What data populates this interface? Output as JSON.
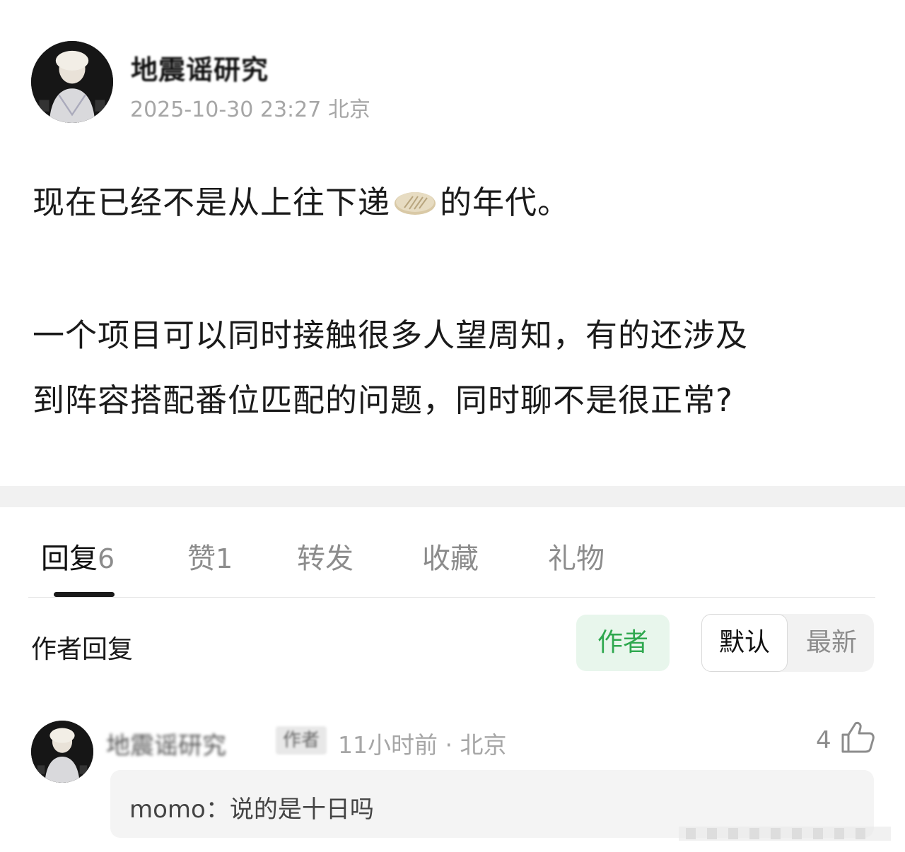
{
  "post": {
    "author_name": "地震谣研究",
    "timestamp": "2025-10-30 23:27",
    "location": "北京",
    "content": {
      "line1_before": "现在已经不是从上往下递",
      "line1_emoji": "pancake-emoji",
      "line1_after": "的年代。",
      "line2": "一个项目可以同时接触很多人望周知，有的还涉及",
      "line3": "到阵容搭配番位匹配的问题，同时聊不是很正常?"
    }
  },
  "tabs": [
    {
      "label": "回复",
      "count": "6"
    },
    {
      "label": "赞",
      "count": "1"
    },
    {
      "label": "转发",
      "count": ""
    },
    {
      "label": "收藏",
      "count": ""
    },
    {
      "label": "礼物",
      "count": ""
    }
  ],
  "replies_section": {
    "title": "作者回复",
    "author_filter": "作者",
    "sort_default": "默认",
    "sort_latest": "最新"
  },
  "comment": {
    "username": "地震谣研究",
    "badge": "作者",
    "time": "11小时前",
    "location": "北京",
    "likes": "4",
    "reply_user": "momo：",
    "reply_text": "说的是十日吗"
  },
  "colors": {
    "accent_green": "#2fa84f",
    "author_chip_bg": "#e8f6ec",
    "meta_gray": "#a6a6a6",
    "section_band": "#f1f1f1"
  }
}
